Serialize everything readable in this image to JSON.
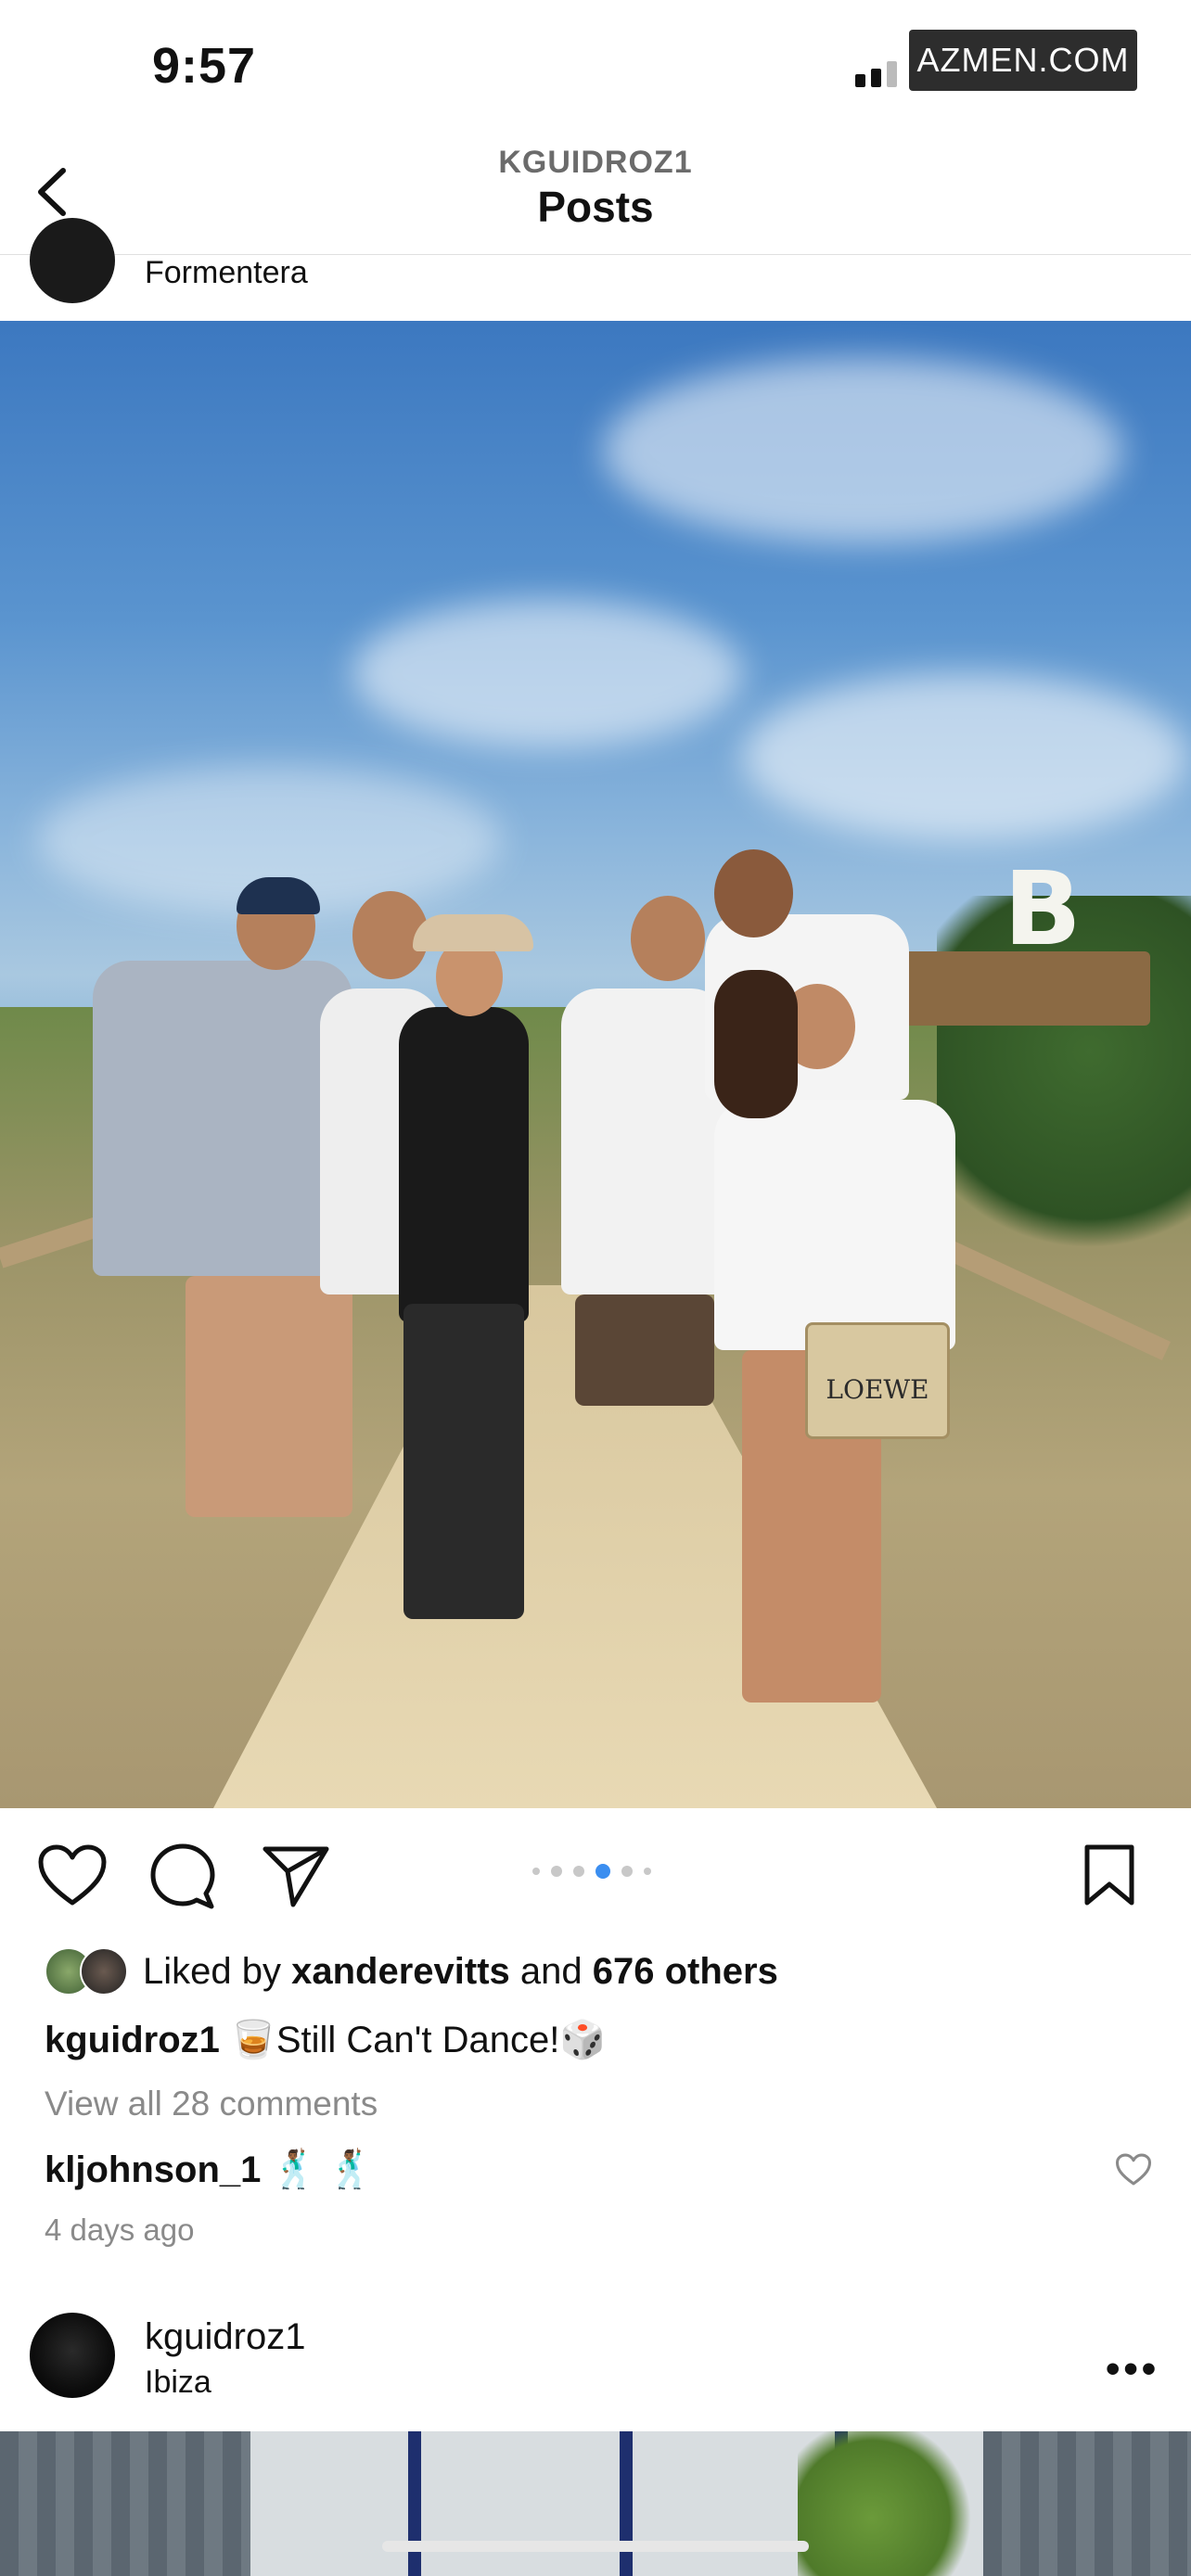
{
  "status_bar": {
    "time": "9:57",
    "watermark": "AZMEN.COM"
  },
  "nav": {
    "username": "KGUIDROZ1",
    "title": "Posts"
  },
  "previous_post": {
    "location": "Formentera"
  },
  "post": {
    "photo_sign": "B",
    "bag_text": "LOEWE",
    "carousel": {
      "count": 6,
      "active_index": 3
    },
    "likes": {
      "prefix": "Liked by ",
      "user": "xanderevitts",
      "middle": " and ",
      "others": "676 others"
    },
    "caption": {
      "user": "kguidroz1",
      "text": " 🥃Still Can't Dance!🎲"
    },
    "view_comments": "View all 28 comments",
    "top_comment": {
      "user": "kljohnson_1",
      "text": " 🕺🏾 🕺🏾"
    },
    "timestamp": "4 days ago"
  },
  "next_post": {
    "username": "kguidroz1",
    "location": "Ibiza",
    "more": "•••"
  },
  "icons": [
    "back-chevron-icon",
    "like-heart-icon",
    "comment-bubble-icon",
    "share-paperplane-icon",
    "bookmark-icon",
    "small-heart-icon",
    "more-dots-icon"
  ]
}
